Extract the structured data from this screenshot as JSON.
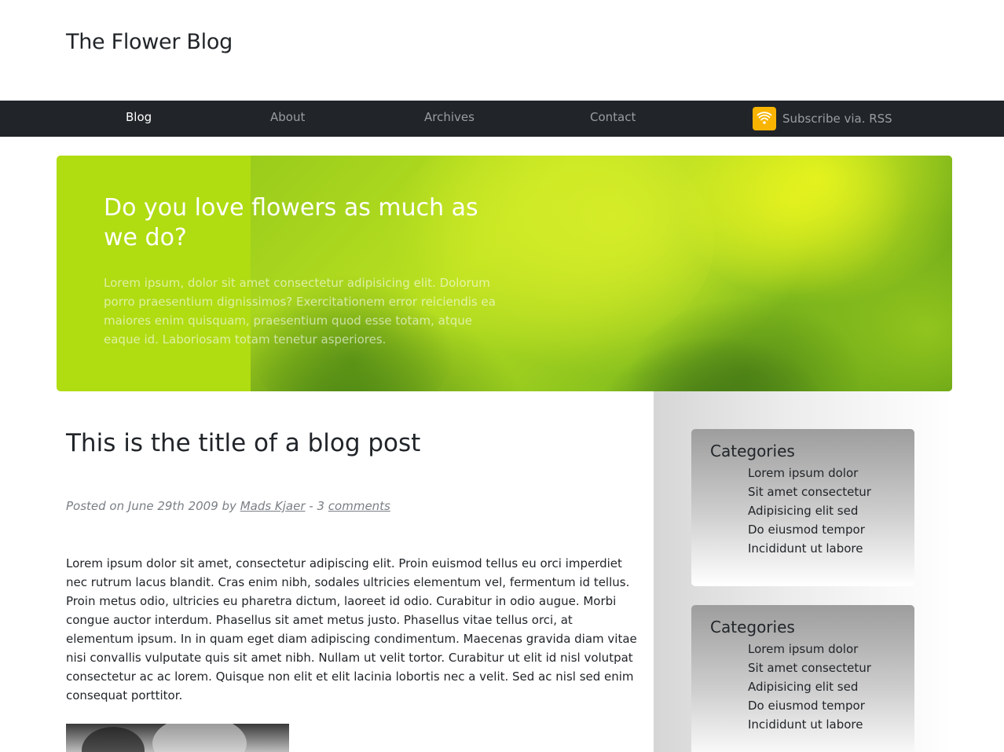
{
  "site": {
    "title": "The Flower Blog"
  },
  "nav": {
    "items": [
      {
        "label": "Blog",
        "active": true
      },
      {
        "label": "About",
        "active": false
      },
      {
        "label": "Archives",
        "active": false
      },
      {
        "label": "Contact",
        "active": false
      }
    ],
    "rss": {
      "label": "Subscribe via. RSS",
      "icon": "rss-icon",
      "color": "#f8b400"
    }
  },
  "hero": {
    "title": "Do you love flowers as much as we do?",
    "body": "Lorem ipsum, dolor sit amet consectetur adipisicing elit. Dolorum porro praesentium dignissimos? Exercitationem error reiciendis ea maiores enim quisquam, praesentium quod esse totam, atque eaque id. Laboriosam totam tenetur asperiores.",
    "accent_color": "#b0dc12"
  },
  "post": {
    "title": "This is the title of a blog post",
    "meta": {
      "prefix": "Posted on June 29th 2009 by ",
      "author": "Mads Kjaer",
      "separator": " - 3 ",
      "comments_label": "comments"
    },
    "body": "Lorem ipsum dolor sit amet, consectetur adipiscing elit. Proin euismod tellus eu orci imperdiet nec rutrum lacus blandit. Cras enim nibh, sodales ultricies elementum vel, fermentum id tellus. Proin metus odio, ultricies eu pharetra dictum, laoreet id odio. Curabitur in odio augue. Morbi congue auctor interdum. Phasellus sit amet metus justo. Phasellus vitae tellus orci, at elementum ipsum. In in quam eget diam adipiscing condimentum. Maecenas gravida diam vitae nisi convallis vulputate quis sit amet nibh. Nullam ut velit tortor. Curabitur ut elit id nisl volutpat consectetur ac ac lorem. Quisque non elit et elit lacinia lobortis nec a velit. Sed ac nisl sed enim consequat porttitor."
  },
  "sidebar": {
    "widgets": [
      {
        "title": "Categories",
        "items": [
          "Lorem ipsum dolor",
          "Sit amet consectetur",
          "Adipisicing elit sed",
          "Do eiusmod tempor",
          "Incididunt ut labore"
        ]
      },
      {
        "title": "Categories",
        "items": [
          "Lorem ipsum dolor",
          "Sit amet consectetur",
          "Adipisicing elit sed",
          "Do eiusmod tempor",
          "Incididunt ut labore"
        ]
      }
    ]
  }
}
